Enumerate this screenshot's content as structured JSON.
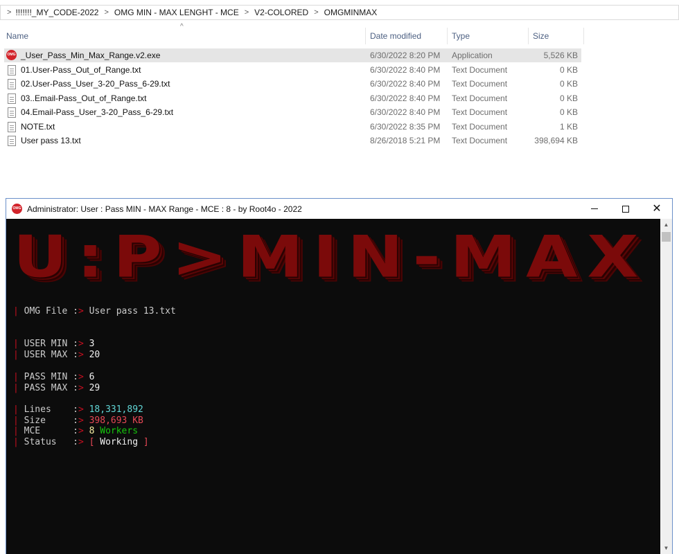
{
  "explorer": {
    "breadcrumb": [
      "!!!!!!!_MY_CODE-2022",
      "OMG MIN - MAX LENGHT - MCE",
      "V2-COLORED",
      "OMGMINMAX"
    ],
    "columns": {
      "name": "Name",
      "date": "Date modified",
      "type": "Type",
      "size": "Size"
    },
    "files": [
      {
        "name": "_User_Pass_Min_Max_Range.v2.exe",
        "date": "6/30/2022 8:20 PM",
        "type": "Application",
        "size": "5,526 KB",
        "icon": "app-icon",
        "selected": true
      },
      {
        "name": "01.User-Pass_Out_of_Range.txt",
        "date": "6/30/2022 8:40 PM",
        "type": "Text Document",
        "size": "0 KB",
        "icon": "text-file-icon"
      },
      {
        "name": "02.User-Pass_User_3-20_Pass_6-29.txt",
        "date": "6/30/2022 8:40 PM",
        "type": "Text Document",
        "size": "0 KB",
        "icon": "text-file-icon"
      },
      {
        "name": "03..Email-Pass_Out_of_Range.txt",
        "date": "6/30/2022 8:40 PM",
        "type": "Text Document",
        "size": "0 KB",
        "icon": "text-file-icon"
      },
      {
        "name": "04.Email-Pass_User_3-20_Pass_6-29.txt",
        "date": "6/30/2022 8:40 PM",
        "type": "Text Document",
        "size": "0 KB",
        "icon": "text-file-icon"
      },
      {
        "name": "NOTE.txt",
        "date": "6/30/2022 8:35 PM",
        "type": "Text Document",
        "size": "1 KB",
        "icon": "text-file-icon"
      },
      {
        "name": "User pass 13.txt",
        "date": "8/26/2018 5:21 PM",
        "type": "Text Document",
        "size": "398,694 KB",
        "icon": "text-file-icon"
      }
    ]
  },
  "console": {
    "title": "Administrator:  User : Pass  MIN - MAX  Range  -  MCE : 8  - by Root4o - 2022",
    "banner": "U:P>MIN-MAX",
    "file_label": "OMG File :",
    "file_value": "User pass 13.txt",
    "user_min_label": "USER MIN :",
    "user_min": "3",
    "user_max_label": "USER MAX :",
    "user_max": "20",
    "pass_min_label": "PASS MIN :",
    "pass_min": "6",
    "pass_max_label": "PASS MAX :",
    "pass_max": "29",
    "lines_label": "Lines    :",
    "lines": "18,331,892",
    "size_label": "Size     :",
    "size_num": "398,693",
    "size_unit": "KB",
    "mce_label": "MCE      :",
    "mce_num": "8",
    "mce_unit": "Workers",
    "status_label": "Status   :",
    "status": "Working",
    "prompt_arrow": ">",
    "bar": "|",
    "bracket_open": "[",
    "bracket_close": "]"
  },
  "colors": {
    "banner": "#7b0a0a",
    "accent_red": "#c50f1f",
    "cyan": "#3a96dd",
    "green": "#16c60c"
  }
}
